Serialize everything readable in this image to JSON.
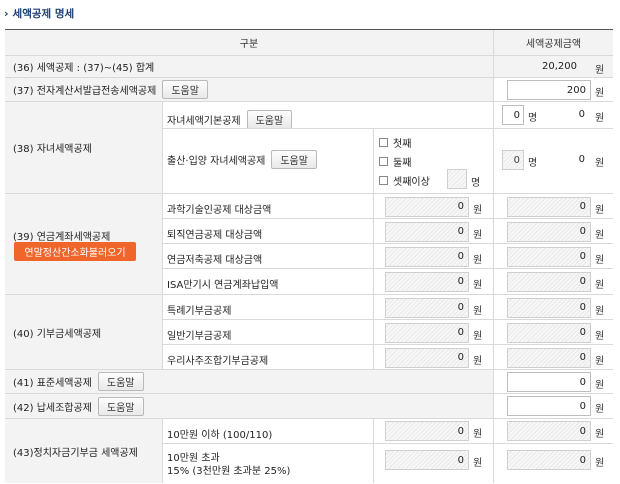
{
  "section_title": "세액공제 명세",
  "header": {
    "category": "구분",
    "amount": "세액공제금액"
  },
  "rows": {
    "r36": {
      "label": "(36) 세액공제 : (37)~(45) 합계",
      "amount": "20,200",
      "unit": "원"
    },
    "r37": {
      "label": "(37) 전자계산서발급전송세액공제",
      "help": "도움말",
      "amount": "200",
      "unit": "원"
    },
    "r38": {
      "label": "(38) 자녀세액공제",
      "child_basic": {
        "label": "자녀세액기본공제",
        "help": "도움말",
        "count": "0",
        "count_unit": "명",
        "amount": "0",
        "unit": "원"
      },
      "birth": {
        "label": "출산·입양 자녀세액공제",
        "help": "도움말",
        "options": [
          "첫째",
          "둘째",
          "셋째이상"
        ],
        "other_unit": "명",
        "count": "0",
        "count_unit": "명",
        "amount": "0",
        "unit": "원"
      }
    },
    "r39": {
      "label": "(39) 연금계좌세액공제",
      "orange_button": "연말정산간소화불러오기",
      "items": [
        {
          "label": "과학기술인공제 대상금액",
          "base": "0",
          "amount": "0"
        },
        {
          "label": "퇴직연금공제 대상금액",
          "base": "0",
          "amount": "0"
        },
        {
          "label": "연금저축공제 대상금액",
          "base": "0",
          "amount": "0"
        },
        {
          "label": "ISA만기시 연금계좌납입액",
          "base": "0",
          "amount": "0"
        }
      ]
    },
    "r40": {
      "label": "(40) 기부금세액공제",
      "items": [
        {
          "label": "특례기부금공제",
          "base": "0",
          "amount": "0"
        },
        {
          "label": "일반기부금공제",
          "base": "0",
          "amount": "0"
        },
        {
          "label": "우리사주조합기부금공제",
          "base": "0",
          "amount": "0"
        }
      ]
    },
    "r41": {
      "label": "(41) 표준세액공제",
      "help": "도움말",
      "amount": "0"
    },
    "r42": {
      "label": "(42) 납세조합공제",
      "help": "도움말",
      "amount": "0"
    },
    "r43": {
      "label": "(43)정치자금기부금 세액공제",
      "items": [
        {
          "label": "10만원 이하 (100/110)",
          "base": "0",
          "amount": "0"
        },
        {
          "label": "10만원 초과",
          "label2": "15% (3천만원 초과분 25%)",
          "base": "0",
          "amount": "0"
        }
      ]
    }
  },
  "unit_won": "원"
}
